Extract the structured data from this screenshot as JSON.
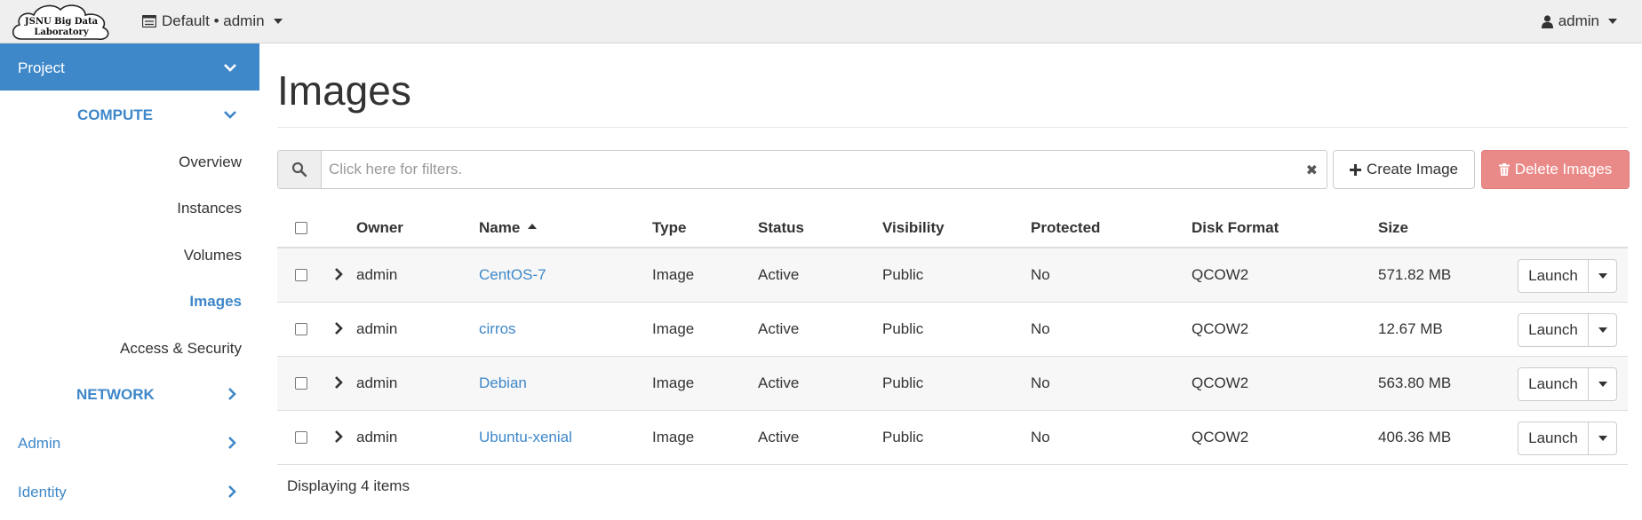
{
  "brand": {
    "logo_line1": "JSNU Big Data",
    "logo_line2": "Laboratory"
  },
  "header": {
    "project_picker": "Default • admin",
    "user": "admin"
  },
  "sidebar": {
    "project": "Project",
    "compute": "COMPUTE",
    "items": [
      {
        "label": "Overview"
      },
      {
        "label": "Instances"
      },
      {
        "label": "Volumes"
      },
      {
        "label": "Images",
        "active": true
      },
      {
        "label": "Access & Security"
      }
    ],
    "network": "NETWORK",
    "admin": "Admin",
    "identity": "Identity"
  },
  "page": {
    "title": "Images"
  },
  "filter": {
    "placeholder": "Click here for filters."
  },
  "actions": {
    "create": "Create Image",
    "delete": "Delete Images"
  },
  "table": {
    "columns": {
      "owner": "Owner",
      "name": "Name",
      "type": "Type",
      "status": "Status",
      "visibility": "Visibility",
      "protected": "Protected",
      "disk_format": "Disk Format",
      "size": "Size"
    },
    "rows": [
      {
        "owner": "admin",
        "name": "CentOS-7",
        "type": "Image",
        "status": "Active",
        "visibility": "Public",
        "protected": "No",
        "disk_format": "QCOW2",
        "size": "571.82 MB",
        "action": "Launch"
      },
      {
        "owner": "admin",
        "name": "cirros",
        "type": "Image",
        "status": "Active",
        "visibility": "Public",
        "protected": "No",
        "disk_format": "QCOW2",
        "size": "12.67 MB",
        "action": "Launch"
      },
      {
        "owner": "admin",
        "name": "Debian",
        "type": "Image",
        "status": "Active",
        "visibility": "Public",
        "protected": "No",
        "disk_format": "QCOW2",
        "size": "563.80 MB",
        "action": "Launch"
      },
      {
        "owner": "admin",
        "name": "Ubuntu-xenial",
        "type": "Image",
        "status": "Active",
        "visibility": "Public",
        "protected": "No",
        "disk_format": "QCOW2",
        "size": "406.36 MB",
        "action": "Launch"
      }
    ],
    "footer": "Displaying 4 items"
  },
  "colors": {
    "accent": "#3e87c9",
    "danger": "#ea8a88",
    "navbar": "#efefef"
  }
}
